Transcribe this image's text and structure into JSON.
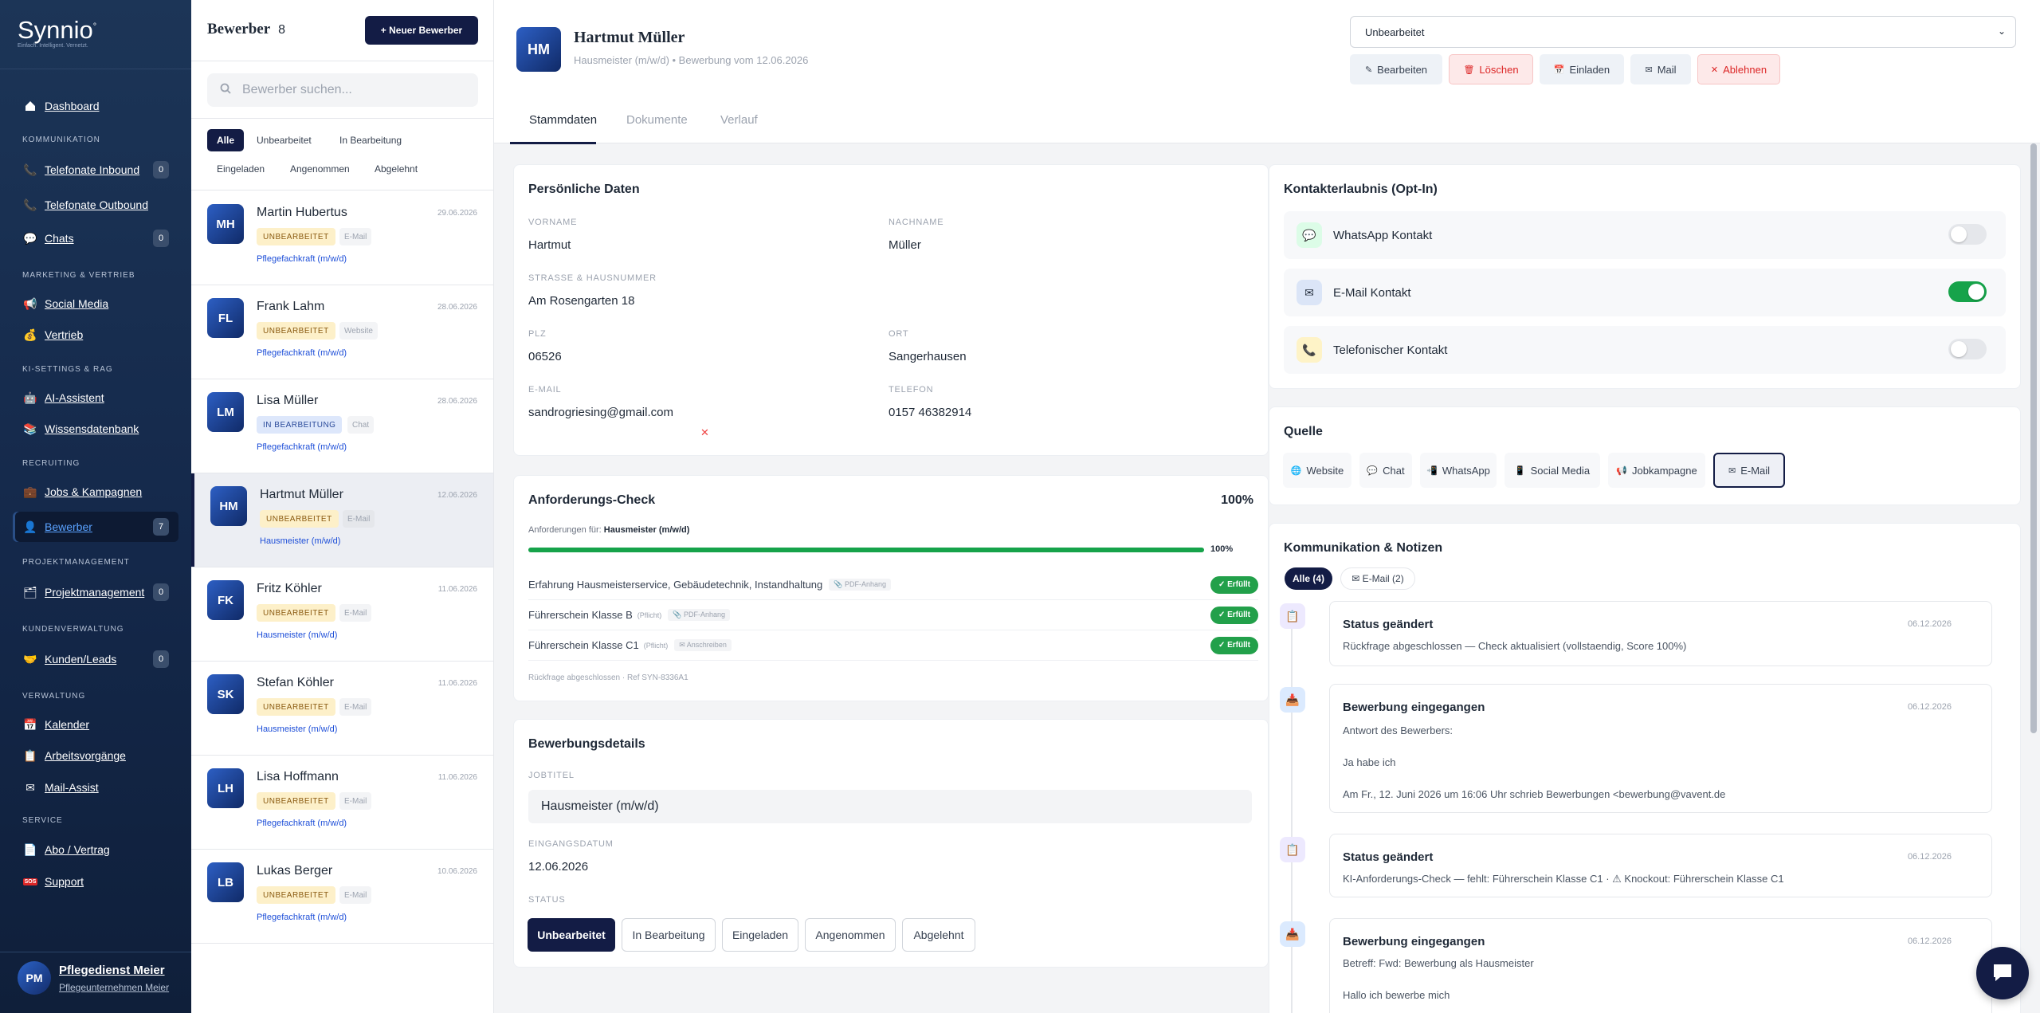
{
  "brand": {
    "name": "Synnio",
    "tagline": "Einfach. Intelligent. Vernetzt."
  },
  "sidebar": {
    "items": [
      {
        "key": "dashboard",
        "label": "Dashboard",
        "icon": "home-icon"
      },
      {
        "key": "telefonate-inbound",
        "label": "Telefonate Inbound",
        "count": "0",
        "icon": "phone-icon"
      },
      {
        "key": "telefonate-outbound",
        "label": "Telefonate Outbound",
        "icon": "phone-icon"
      },
      {
        "key": "chats",
        "label": "Chats",
        "count": "0",
        "icon": "chat-bubble-icon"
      },
      {
        "key": "social-media",
        "label": "Social Media",
        "icon": "megaphone-icon"
      },
      {
        "key": "vertrieb",
        "label": "Vertrieb",
        "icon": "money-bag-icon"
      },
      {
        "key": "ai-assistent",
        "label": "AI-Assistent",
        "icon": "robot-icon"
      },
      {
        "key": "wissensdatenbank",
        "label": "Wissensdatenbank",
        "icon": "books-icon"
      },
      {
        "key": "jobs",
        "label": "Jobs & Kampagnen",
        "icon": "briefcase-icon"
      },
      {
        "key": "bewerber",
        "label": "Bewerber",
        "count": "7",
        "icon": "user-icon"
      },
      {
        "key": "projektmanagement",
        "label": "Projektmanagement",
        "count": "0",
        "icon": "folder-icon"
      },
      {
        "key": "kunden",
        "label": "Kunden/Leads",
        "count": "0",
        "icon": "handshake-icon"
      },
      {
        "key": "kalender",
        "label": "Kalender",
        "icon": "calendar-icon"
      },
      {
        "key": "arbeitsvorgaenge",
        "label": "Arbeitsvorgänge",
        "icon": "clipboard-icon"
      },
      {
        "key": "mail-assist",
        "label": "Mail-Assist",
        "icon": "envelope-icon"
      },
      {
        "key": "abo",
        "label": "Abo / Vertrag",
        "icon": "document-icon"
      },
      {
        "key": "support",
        "label": "Support",
        "icon": "sos-icon"
      }
    ],
    "sections": [
      "KOMMUNIKATION",
      "MARKETING & VERTRIEB",
      "KI-SETTINGS & RAG",
      "RECRUITING",
      "PROJEKTMANAGEMENT",
      "KUNDENVERWALTUNG",
      "VERWALTUNG",
      "SERVICE"
    ],
    "user": {
      "initials": "PM",
      "name": "Pflegedienst Meier",
      "org": "Pflegeunternehmen Meier"
    }
  },
  "list": {
    "title": "Bewerber",
    "count": "8",
    "new_button": "+ Neuer Bewerber",
    "search_placeholder": "Bewerber suchen...",
    "filters": [
      "Alle",
      "Unbearbeitet",
      "In Bearbeitung",
      "Eingeladen",
      "Angenommen",
      "Abgelehnt"
    ],
    "candidates": [
      {
        "initials": "MH",
        "name": "Martin Hubertus",
        "date": "29.06.2026",
        "status": "UNBEARBEITET",
        "source": "E-Mail",
        "job": "Pflegefachkraft (m/w/d)"
      },
      {
        "initials": "FL",
        "name": "Frank Lahm",
        "date": "28.06.2026",
        "status": "UNBEARBEITET",
        "source": "Website",
        "job": "Pflegefachkraft (m/w/d)"
      },
      {
        "initials": "LM",
        "name": "Lisa Müller",
        "date": "28.06.2026",
        "status": "IN BEARBEITUNG",
        "source": "Chat",
        "job": "Pflegefachkraft (m/w/d)"
      },
      {
        "initials": "HM",
        "name": "Hartmut Müller",
        "date": "12.06.2026",
        "status": "UNBEARBEITET",
        "source": "E-Mail",
        "job": "Hausmeister (m/w/d)"
      },
      {
        "initials": "FK",
        "name": "Fritz Köhler",
        "date": "11.06.2026",
        "status": "UNBEARBEITET",
        "source": "E-Mail",
        "job": "Hausmeister (m/w/d)"
      },
      {
        "initials": "SK",
        "name": "Stefan Köhler",
        "date": "11.06.2026",
        "status": "UNBEARBEITET",
        "source": "E-Mail",
        "job": "Hausmeister (m/w/d)"
      },
      {
        "initials": "LH",
        "name": "Lisa Hoffmann",
        "date": "11.06.2026",
        "status": "UNBEARBEITET",
        "source": "E-Mail",
        "job": "Pflegefachkraft (m/w/d)"
      },
      {
        "initials": "LB",
        "name": "Lukas Berger",
        "date": "10.06.2026",
        "status": "UNBEARBEITET",
        "source": "E-Mail",
        "job": "Pflegefachkraft (m/w/d)"
      }
    ]
  },
  "detail": {
    "initials": "HM",
    "name": "Hartmut Müller",
    "subtitle": "Hausmeister (m/w/d) • Bewerbung vom 12.06.2026",
    "status_select": "Unbearbeitet",
    "actions": {
      "edit": "Bearbeiten",
      "delete": "Löschen",
      "invite": "Einladen",
      "mail": "Mail",
      "reject": "Ablehnen"
    },
    "tabs": [
      "Stammdaten",
      "Dokumente",
      "Verlauf"
    ],
    "personal": {
      "title": "Persönliche Daten",
      "vorname_label": "VORNAME",
      "vorname": "Hartmut",
      "nachname_label": "NACHNAME",
      "nachname": "Müller",
      "strasse_label": "STRASSE & HAUSNUMMER",
      "strasse": "Am Rosengarten 18",
      "plz_label": "PLZ",
      "plz": "06526",
      "ort_label": "ORT",
      "ort": "Sangerhausen",
      "email_label": "E-MAIL",
      "email": "sandrogriesing@gmail.com",
      "telefon_label": "TELEFON",
      "telefon": "0157 46382914",
      "x_mark": "✕"
    },
    "requirements": {
      "title": "Anforderungs-Check",
      "score": "100%",
      "for_label": "Anforderungen für:",
      "for_job": "Hausmeister (m/w/d)",
      "progress": 1.0,
      "progress_label": "100%",
      "items": [
        {
          "text": "Erfahrung Hausmeisterservice, Gebäudetechnik, Instandhaltung",
          "mand": "",
          "tag": "📎 PDF-Anhang",
          "status": "✓ Erfüllt"
        },
        {
          "text": "Führerschein Klasse B",
          "mand": "(Pflicht)",
          "tag": "📎 PDF-Anhang",
          "status": "✓ Erfüllt"
        },
        {
          "text": "Führerschein Klasse C1",
          "mand": "(Pflicht)",
          "tag": "✉ Anschreiben",
          "status": "✓ Erfüllt"
        }
      ],
      "footer": "Rückfrage abgeschlossen · Ref SYN-8336A1"
    },
    "application": {
      "title": "Bewerbungsdetails",
      "job_label": "JOBTITEL",
      "job": "Hausmeister (m/w/d)",
      "date_label": "EINGANGSDATUM",
      "date": "12.06.2026",
      "status_label": "STATUS",
      "statuses": [
        "Unbearbeitet",
        "In Bearbeitung",
        "Eingeladen",
        "Angenommen",
        "Abgelehnt"
      ]
    },
    "optin": {
      "title": "Kontakterlaubnis (Opt-In)",
      "items": [
        {
          "label": "WhatsApp Kontakt",
          "on": false,
          "icon": "chat-bubble-icon"
        },
        {
          "label": "E-Mail Kontakt",
          "on": true,
          "icon": "envelope-icon"
        },
        {
          "label": "Telefonischer Kontakt",
          "on": false,
          "icon": "phone-icon"
        }
      ]
    },
    "source": {
      "title": "Quelle",
      "chips": [
        "Website",
        "Chat",
        "WhatsApp",
        "Social Media",
        "Jobkampagne",
        "E-Mail"
      ],
      "selected": "E-Mail"
    },
    "communication": {
      "title": "Kommunikation & Notizen",
      "filter_all": "Alle (4)",
      "filter_mail": "✉ E-Mail (2)",
      "entries": [
        {
          "title": "Status geändert",
          "date": "06.12.2026",
          "lines": [
            "Rückfrage abgeschlossen — Check aktualisiert (vollstaendig, Score 100%)"
          ]
        },
        {
          "title": "Bewerbung eingegangen",
          "date": "06.12.2026",
          "lines": [
            "Antwort des Bewerbers:",
            "Ja habe ich",
            "Am Fr., 12. Juni 2026 um 16:06 Uhr schrieb Bewerbungen <bewerbung@vavent.de"
          ]
        },
        {
          "title": "Status geändert",
          "date": "06.12.2026",
          "lines": [
            "KI-Anforderungs-Check — fehlt: Führerschein Klasse C1 · ⚠ Knockout: Führerschein Klasse C1"
          ]
        },
        {
          "title": "Bewerbung eingegangen",
          "date": "06.12.2026",
          "lines": [
            "Betreff: Fwd: Bewerbung als Hausmeister",
            "Hallo ich bewerbe mich"
          ]
        }
      ]
    }
  },
  "colors": {
    "sidebar": "#1c3557",
    "accent": "#131c45",
    "success": "#16a34a",
    "danger": "#dc2626",
    "link": "#1d4ed8"
  }
}
